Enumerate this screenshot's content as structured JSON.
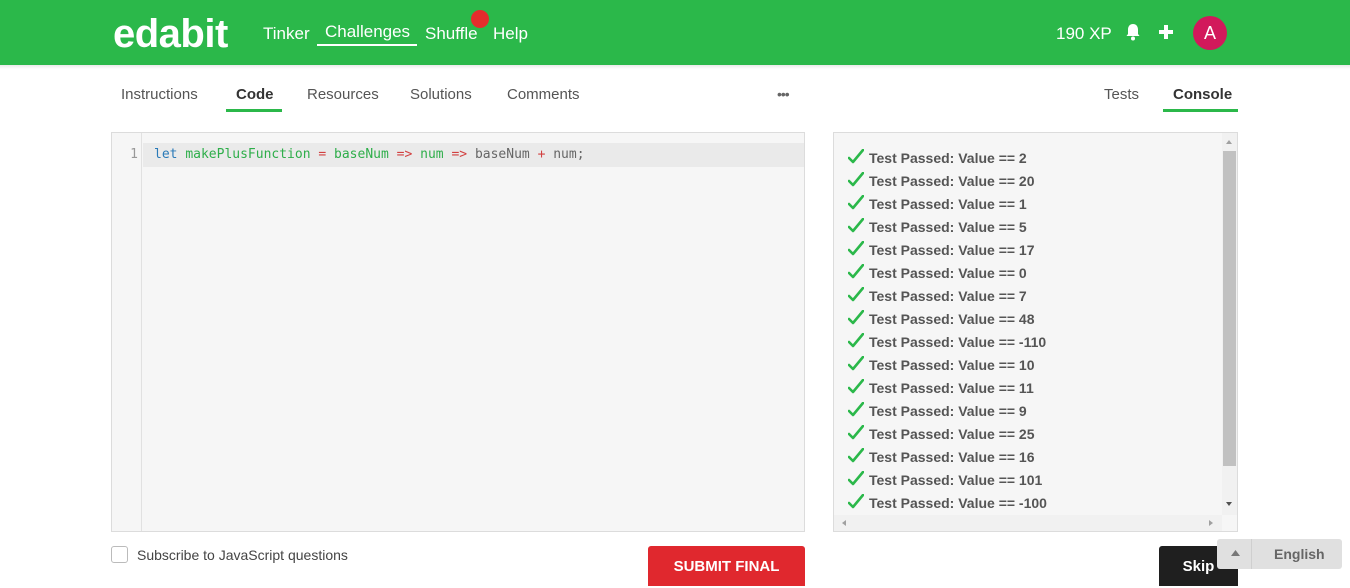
{
  "header": {
    "logo": "edabit",
    "nav": [
      {
        "label": "Tinker"
      },
      {
        "label": "Challenges"
      },
      {
        "label": "Shuffle"
      },
      {
        "label": "Help"
      }
    ],
    "active_nav": "Challenges",
    "xp": "190 XP",
    "avatar_letter": "A",
    "icons": [
      "bell-icon",
      "plus-icon"
    ],
    "colors": {
      "brand": "#2bb84a",
      "avatar": "#d2195b",
      "notification": "#e52c2c"
    }
  },
  "left_tabs": [
    {
      "label": "Instructions"
    },
    {
      "label": "Code"
    },
    {
      "label": "Resources"
    },
    {
      "label": "Solutions"
    },
    {
      "label": "Comments"
    }
  ],
  "active_left_tab": "Code",
  "more_label": "•••",
  "right_tabs": [
    {
      "label": "Tests"
    },
    {
      "label": "Console"
    }
  ],
  "active_right_tab": "Console",
  "editor": {
    "line_number": "1",
    "tokens": [
      {
        "text": "let",
        "kind": "keyword"
      },
      {
        "text": " ",
        "kind": "space"
      },
      {
        "text": "makePlusFunction",
        "kind": "function"
      },
      {
        "text": " ",
        "kind": "space"
      },
      {
        "text": "=",
        "kind": "operator"
      },
      {
        "text": " ",
        "kind": "space"
      },
      {
        "text": "baseNum",
        "kind": "function"
      },
      {
        "text": " ",
        "kind": "space"
      },
      {
        "text": "=>",
        "kind": "operator"
      },
      {
        "text": " ",
        "kind": "space"
      },
      {
        "text": "num",
        "kind": "function"
      },
      {
        "text": " ",
        "kind": "space"
      },
      {
        "text": "=>",
        "kind": "operator"
      },
      {
        "text": " ",
        "kind": "space"
      },
      {
        "text": "baseNum",
        "kind": "variable"
      },
      {
        "text": " ",
        "kind": "space"
      },
      {
        "text": "+",
        "kind": "operator"
      },
      {
        "text": " ",
        "kind": "space"
      },
      {
        "text": "num;",
        "kind": "variable"
      }
    ]
  },
  "console": {
    "results": [
      "Test Passed: Value == 2",
      "Test Passed: Value == 20",
      "Test Passed: Value == 1",
      "Test Passed: Value == 5",
      "Test Passed: Value == 17",
      "Test Passed: Value == 0",
      "Test Passed: Value == 7",
      "Test Passed: Value == 48",
      "Test Passed: Value == -110",
      "Test Passed: Value == 10",
      "Test Passed: Value == 11",
      "Test Passed: Value == 9",
      "Test Passed: Value == 25",
      "Test Passed: Value == 16",
      "Test Passed: Value == 101",
      "Test Passed: Value == -100"
    ],
    "check_color": "#2bb84a"
  },
  "footer": {
    "subscribe_label": "Subscribe to JavaScript questions",
    "subscribe_checked": false,
    "submit_label": "SUBMIT FINAL",
    "skip_label": "Skip",
    "language": "English"
  }
}
